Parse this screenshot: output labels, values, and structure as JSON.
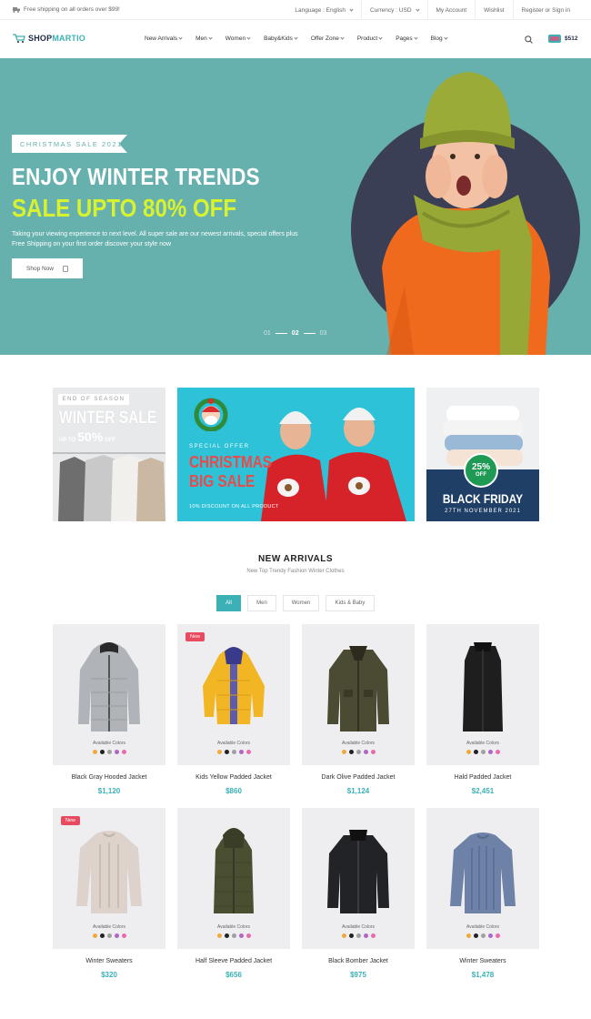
{
  "topbar": {
    "shipping": "Free shipping on all orders over $99!",
    "language": "Language : English",
    "currency": "Currency : USD",
    "account": "My Account",
    "wishlist": "Wishlist",
    "register": "Register or Sign in"
  },
  "brand": {
    "part1": "SHOP",
    "part2": "MARTIO"
  },
  "nav": [
    "New Arrivals",
    "Men",
    "Women",
    "Baby&Kids",
    "Offer Zone",
    "Product",
    "Pages",
    "Blog"
  ],
  "cart": {
    "amount": "$512"
  },
  "hero": {
    "ribbon": "CHRISTMAS SALE 2021",
    "title": "ENJOY WINTER TRENDS",
    "subtitle": "SALE UPTO 80% OFF",
    "description": "Taking your viewing experience to next level. All super sale are our newest arrivals, special offers plus Free Shipping on your first order discover your style now",
    "button": "Shop Now",
    "slides": [
      "01",
      "02",
      "03"
    ],
    "active_slide": "02"
  },
  "banners": {
    "winter": {
      "tag": "END OF SEASON",
      "title": "WINTER SALE",
      "upto": "UP TO",
      "percent": "50%",
      "off": "OFF"
    },
    "christmas": {
      "tag": "SPECIAL OFFER",
      "title_line1": "CHRISTMAS",
      "title_line2": "BIG SALE",
      "discount": "10% DISCOUNT ON ALL PRODUCT"
    },
    "black_friday": {
      "badge_percent": "25%",
      "badge_off": "OFF",
      "title": "BLACK FRIDAY",
      "date": "27TH NOVEMBER 2021"
    }
  },
  "section": {
    "title": "NEW ARRIVALS",
    "subtitle": "New Top Trendy Fashion Winter Clothes",
    "filters": [
      "All",
      "Men",
      "Women",
      "Kids & Baby"
    ],
    "active_filter": "All"
  },
  "available_colors_label": "Available Colors",
  "new_badge": "New",
  "swatches": [
    "#f2a93b",
    "#222222",
    "#a0a0a0",
    "#b066c6",
    "#e86bb0"
  ],
  "products": [
    {
      "name": "Black Gray Hooded Jacket",
      "price": "$1,120"
    },
    {
      "name": "Kids Yellow Padded Jacket",
      "price": "$860"
    },
    {
      "name": "Dark Olive Padded Jacket",
      "price": "$1,124"
    },
    {
      "name": "Hald Padded Jacket",
      "price": "$2,451"
    },
    {
      "name": "Winter Sweaters",
      "price": "$320"
    },
    {
      "name": "Half Sleeve Padded Jacket",
      "price": "$656"
    },
    {
      "name": "Black Bomber Jacket",
      "price": "$975"
    },
    {
      "name": "Winter Sweaters",
      "price": "$1,478"
    }
  ],
  "colors": {
    "accent": "#3bb1b5",
    "hero_bg": "#66b0ae",
    "lime": "#d7f22f",
    "sale_red": "#e84b5f"
  }
}
